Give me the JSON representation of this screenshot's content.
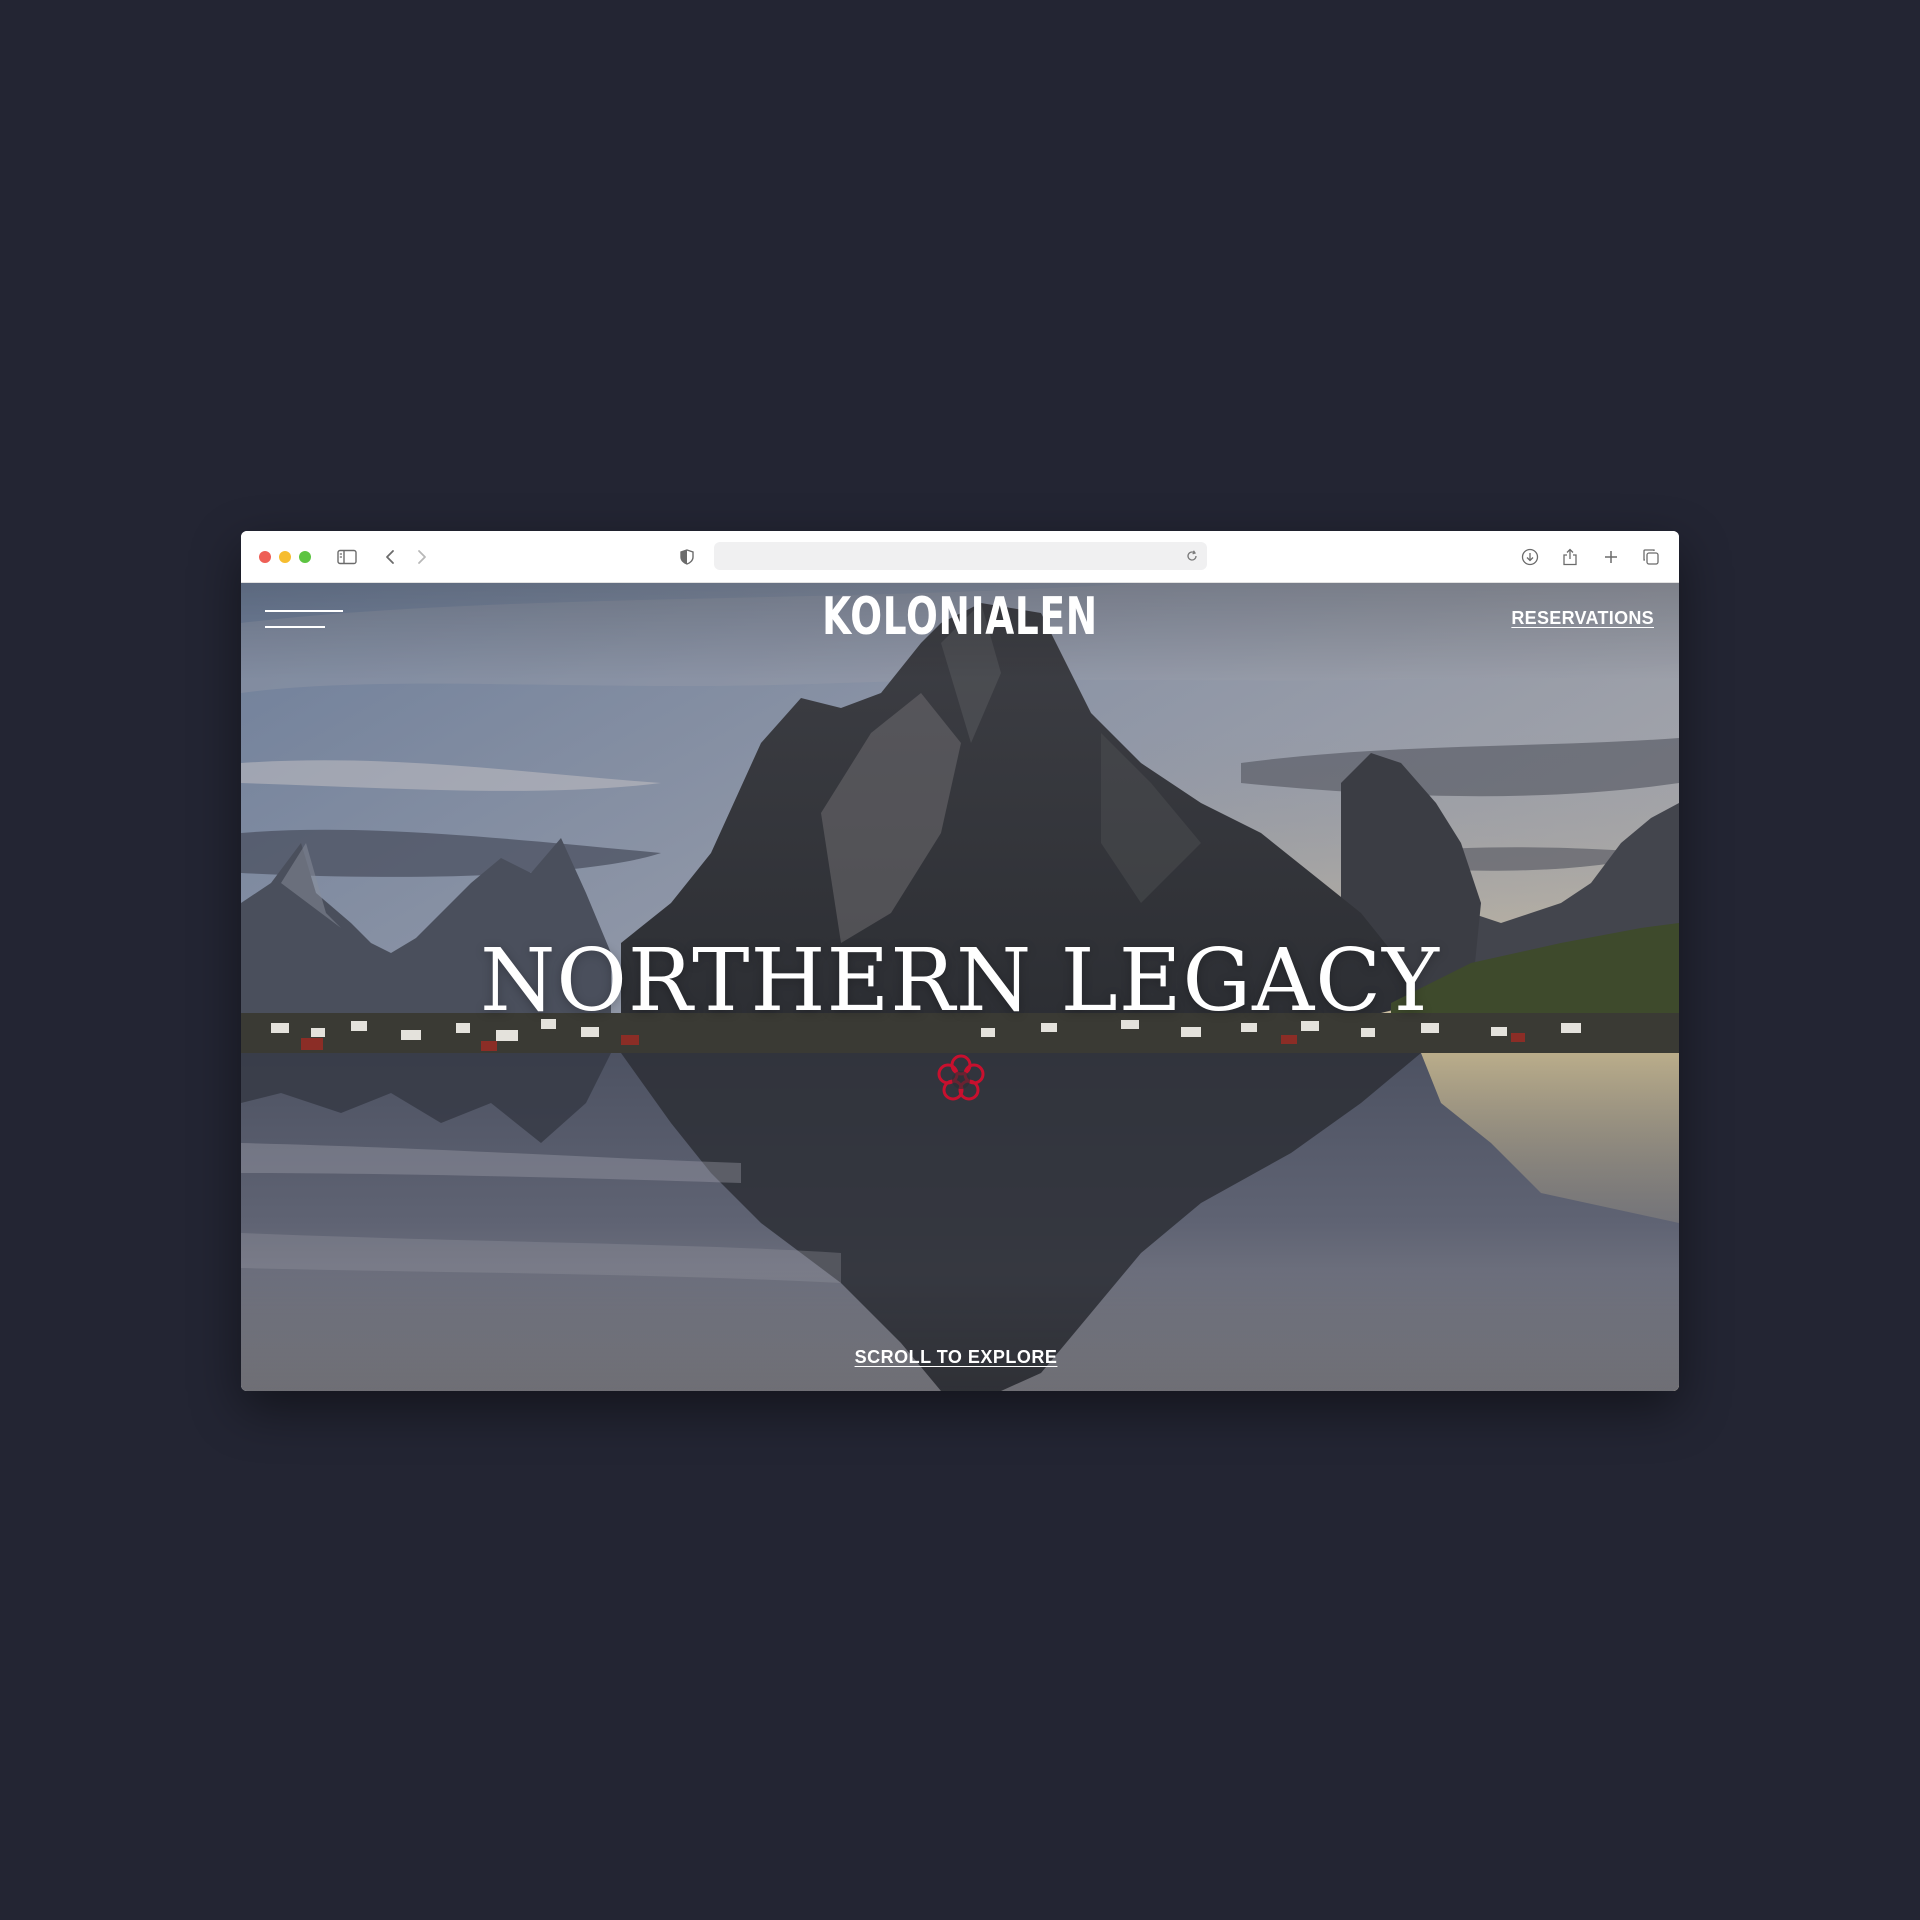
{
  "browser": {
    "window_controls": [
      "close",
      "minimize",
      "maximize"
    ],
    "colors": {
      "close": "#ee5f56",
      "minimize": "#f6bd30",
      "maximize": "#5dc442"
    },
    "url": "",
    "icons": [
      "sidebar-icon",
      "back-icon",
      "forward-icon",
      "shield-icon",
      "reload-icon",
      "download-icon",
      "share-icon",
      "new-tab-icon",
      "tabs-overview-icon"
    ]
  },
  "site": {
    "logo": "KOLONIALEN",
    "nav": {
      "reservations_label": "RESERVATIONS",
      "menu_icon": "hamburger-menu-icon"
    },
    "hero": {
      "headline": "NORTHERN LEGACY",
      "emblem_icon": "michelin-star-icon",
      "emblem_color": "#c8102e",
      "scroll_label": "SCROLL TO EXPLORE"
    }
  },
  "theme": {
    "page_background": "#232533",
    "text_color": "#ffffff"
  }
}
